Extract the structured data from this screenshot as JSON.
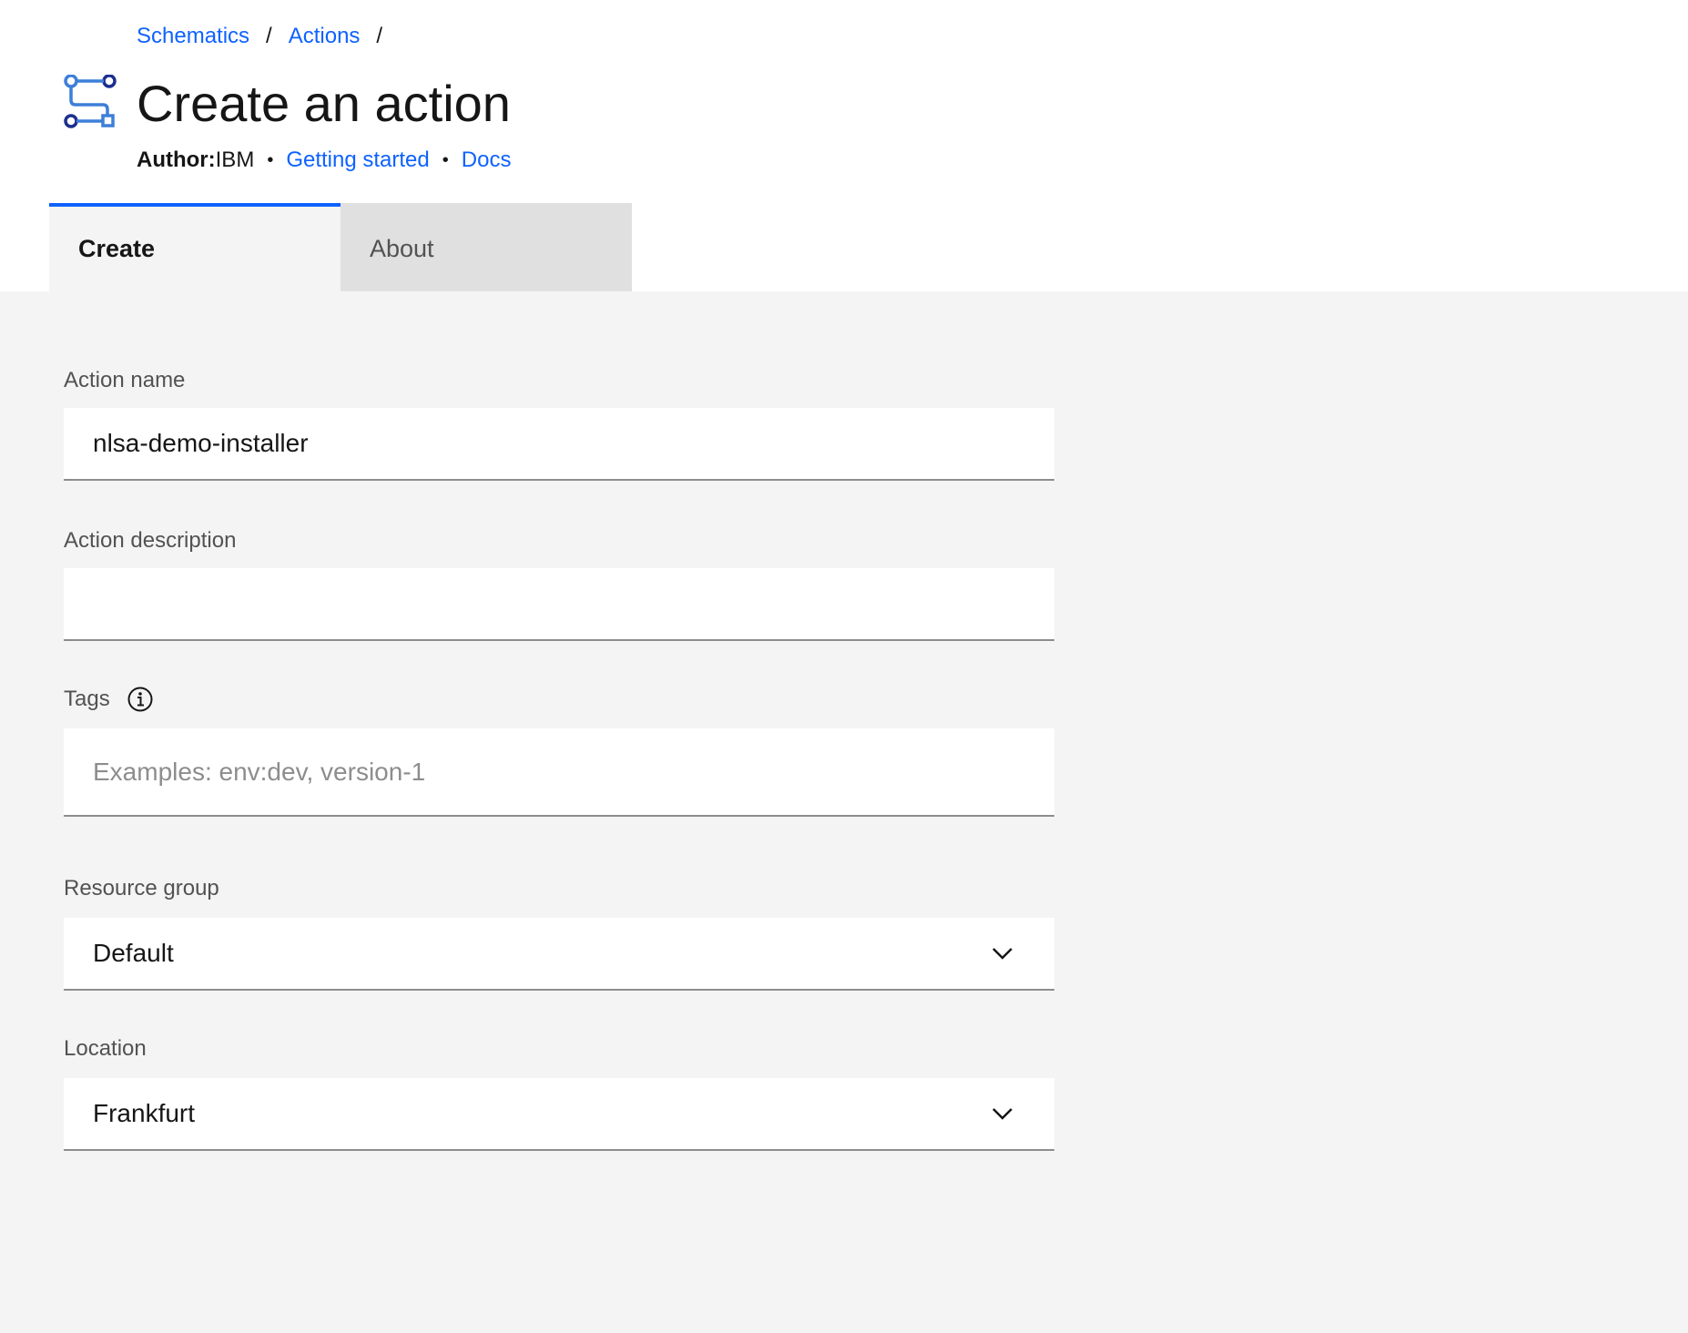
{
  "breadcrumb": {
    "items": [
      {
        "label": "Schematics"
      },
      {
        "label": "Actions"
      }
    ],
    "separator": "/"
  },
  "page": {
    "title": "Create an action",
    "icon": "schematics-action-icon"
  },
  "meta": {
    "author_label": "Author:",
    "author_value": "IBM",
    "separator": "•",
    "getting_started": "Getting started",
    "docs": "Docs"
  },
  "tabs": [
    {
      "label": "Create",
      "active": true
    },
    {
      "label": "About",
      "active": false
    }
  ],
  "form": {
    "action_name": {
      "label": "Action name",
      "value": "nlsa-demo-installer"
    },
    "action_description": {
      "label": "Action description",
      "value": ""
    },
    "tags": {
      "label": "Tags",
      "placeholder": "Examples: env:dev, version-1",
      "value": "",
      "info_icon": "info-icon"
    },
    "resource_group": {
      "label": "Resource group",
      "selected": "Default"
    },
    "location": {
      "label": "Location",
      "selected": "Frankfurt"
    }
  },
  "colors": {
    "accent": "#0f62fe",
    "header_bg": "#ffffff",
    "content_bg": "#f4f4f4",
    "inactive_tab_bg": "#e0e0e0",
    "text": "#161616",
    "label": "#525252"
  }
}
